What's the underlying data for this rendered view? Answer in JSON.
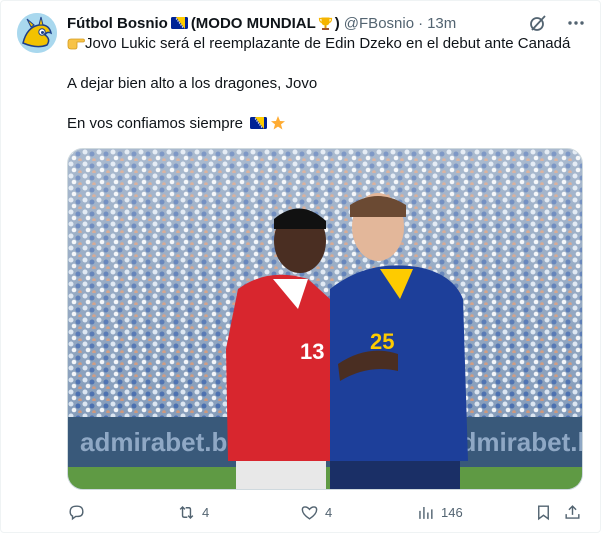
{
  "tweet": {
    "display_name": "Fútbol Bosnio",
    "display_suffix": "(MODO MUNDIAL",
    "display_close": ")",
    "handle": "@FBosnio",
    "dot": "·",
    "time": "13m",
    "lines": [
      "Jovo Lukic será el reemplazante de Edin Dzeko en el debut ante Canadá",
      "A dejar bien alto a los dragones, Jovo",
      "En vos confiamos siempre"
    ],
    "image": {
      "ad_left": "admirabet.ba",
      "ad_right": "admirabet.ba",
      "shirt_red_number": "13",
      "shirt_blue_number": "25"
    }
  },
  "actions": {
    "reply_count": "",
    "retweet_count": "4",
    "like_count": "4",
    "views_count": "146"
  },
  "icons": [
    "grok-icon",
    "more-icon",
    "point-right-emoji",
    "bosnia-flag-emoji",
    "trophy-emoji",
    "star-emoji",
    "reply-icon",
    "retweet-icon",
    "like-icon",
    "views-icon",
    "bookmark-icon",
    "share-icon"
  ],
  "colors": {
    "text": "#0f1419",
    "secondary": "#536471",
    "bosnia_blue": "#002395",
    "bosnia_yellow": "#fecb00"
  }
}
